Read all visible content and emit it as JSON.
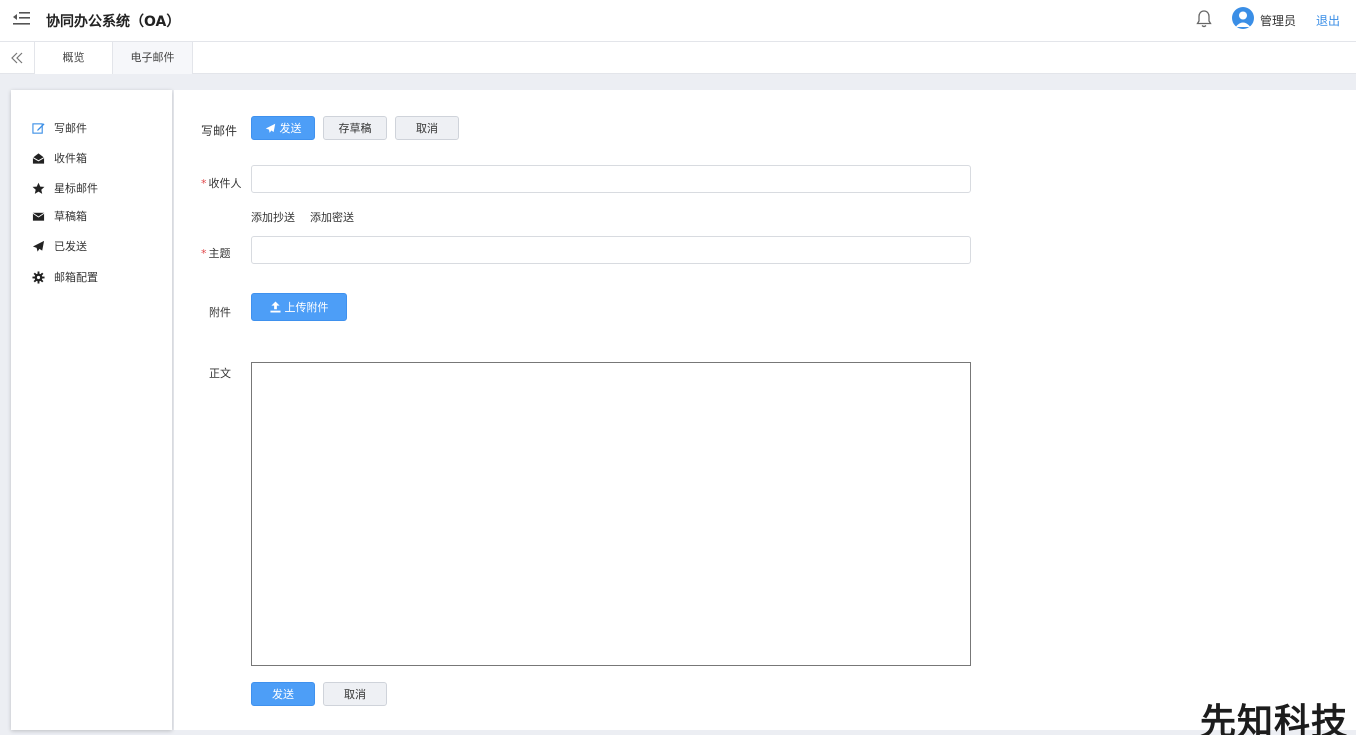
{
  "header": {
    "title": "协同办公系统（OA）",
    "user_name": "管理员",
    "logout_label": "退出"
  },
  "tabs": [
    {
      "label": "概览"
    },
    {
      "label": "电子邮件"
    }
  ],
  "sidebar": {
    "items": [
      {
        "label": "写邮件",
        "icon": "edit-icon"
      },
      {
        "label": "收件箱",
        "icon": "inbox-icon"
      },
      {
        "label": "星标邮件",
        "icon": "star-icon"
      },
      {
        "label": "草稿箱",
        "icon": "envelope-icon"
      },
      {
        "label": "已发送",
        "icon": "send-icon"
      },
      {
        "label": "邮箱配置",
        "icon": "gear-icon"
      }
    ]
  },
  "compose": {
    "section_title": "写邮件",
    "send_label": "发送",
    "save_draft_label": "存草稿",
    "cancel_label": "取消",
    "recipient_label": "收件人",
    "recipient_value": "",
    "add_cc_label": "添加抄送",
    "add_bcc_label": "添加密送",
    "subject_label": "主题",
    "subject_value": "",
    "attachment_label": "附件",
    "upload_label": "上传附件",
    "body_label": "正文",
    "body_value": "",
    "required_mark": "*",
    "bottom_send_label": "发送",
    "bottom_cancel_label": "取消"
  },
  "watermark": "先知科技",
  "colors": {
    "accent": "#4d9ef7",
    "link": "#3a8ee6",
    "required": "#e0464a"
  }
}
